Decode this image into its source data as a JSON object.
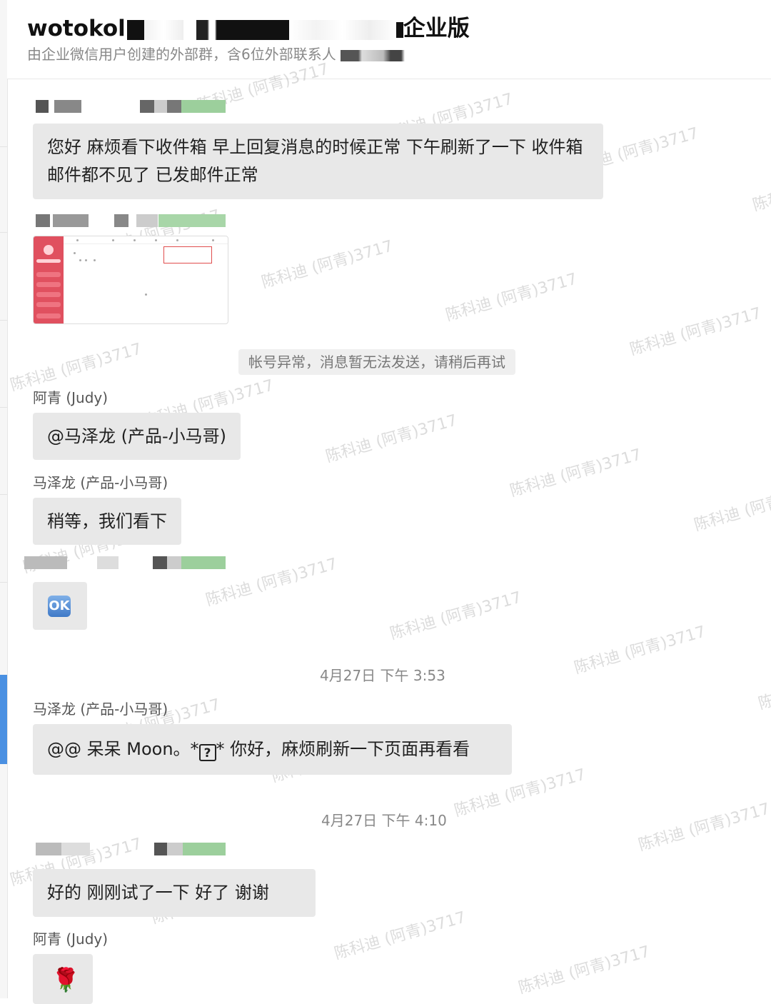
{
  "header": {
    "title_prefix": "wotokol",
    "title_suffix": "企业版",
    "subtitle": "由企业微信用户创建的外部群，含6位外部联系人"
  },
  "messages": {
    "m1_text": "您好 麻烦看下收件箱 早上回复消息的时候正常 下午刷新了一下 收件箱邮件都不见了  已发邮件正常",
    "system_notice": "帐号异常，消息暂无法发送，请稍后再试",
    "sender_judy": "阿青 (Judy)",
    "m3_text": "@马泽龙 (产品-小马哥)",
    "sender_ma": "马泽龙 (产品-小马哥)",
    "m4_text": "稍等，我们看下",
    "ok_emoji": "OK",
    "time1": "4月27日 下午 3:53",
    "m6_prefix": "@@ 呆呆 Moon。*",
    "m6_question": "?",
    "m6_suffix": "* 你好，麻烦刷新一下页面再看看",
    "time2": "4月27日 下午 4:10",
    "m7_text": "好的  刚刚试了一下 好了  谢谢",
    "rose_emoji": "🌹"
  },
  "watermark": "陈科迪 (阿青)3717"
}
